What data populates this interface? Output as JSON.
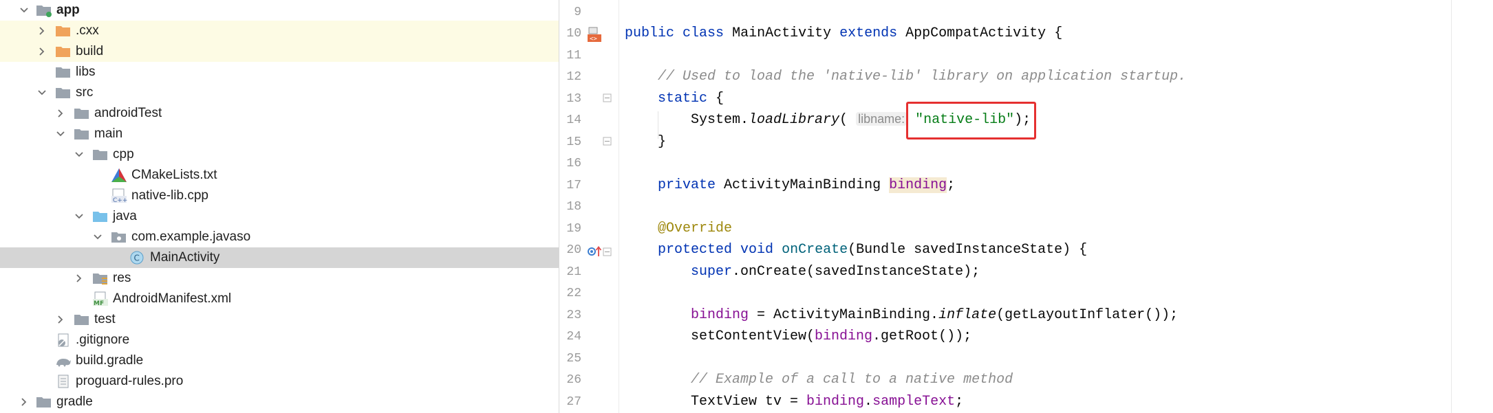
{
  "project_tree": {
    "items": [
      {
        "label": "app",
        "icon": "module-folder-icon",
        "bold": true
      },
      {
        "label": ".cxx",
        "icon": "orange-folder-icon"
      },
      {
        "label": "build",
        "icon": "orange-folder-icon"
      },
      {
        "label": "libs",
        "icon": "folder-icon"
      },
      {
        "label": "src",
        "icon": "folder-icon"
      },
      {
        "label": "androidTest",
        "icon": "folder-icon"
      },
      {
        "label": "main",
        "icon": "folder-icon"
      },
      {
        "label": "cpp",
        "icon": "folder-icon"
      },
      {
        "label": "CMakeLists.txt",
        "icon": "cmake-icon"
      },
      {
        "label": "native-lib.cpp",
        "icon": "cpp-file-icon"
      },
      {
        "label": "java",
        "icon": "source-folder-icon"
      },
      {
        "label": "com.example.javaso",
        "icon": "package-icon"
      },
      {
        "label": "MainActivity",
        "icon": "java-class-icon"
      },
      {
        "label": "res",
        "icon": "resources-folder-icon"
      },
      {
        "label": "AndroidManifest.xml",
        "icon": "manifest-icon"
      },
      {
        "label": "test",
        "icon": "folder-icon"
      },
      {
        "label": ".gitignore",
        "icon": "gitignore-icon"
      },
      {
        "label": "build.gradle",
        "icon": "gradle-icon"
      },
      {
        "label": "proguard-rules.pro",
        "icon": "file-icon"
      },
      {
        "label": "gradle",
        "icon": "folder-icon"
      }
    ]
  },
  "editor": {
    "line_numbers": [
      "9",
      "10",
      "11",
      "12",
      "13",
      "14",
      "15",
      "16",
      "17",
      "18",
      "19",
      "20",
      "21",
      "22",
      "23",
      "24",
      "25",
      "26",
      "27"
    ],
    "code": {
      "l10": {
        "public": "public",
        "class": "class",
        "name": "MainActivity",
        "extends": "extends",
        "parent": "AppCompatActivity",
        "brace": "{"
      },
      "l12": "// Used to load the 'native-lib' library on application startup.",
      "l13": {
        "static": "static",
        "brace": "{"
      },
      "l14": {
        "sys": "System.",
        "call": "loadLibrary",
        "open": "(",
        "hint": "libname:",
        "str": "\"native-lib\"",
        "close": ");"
      },
      "l15": "}",
      "l17": {
        "private": "private",
        "type": "ActivityMainBinding",
        "field": "binding",
        "semi": ";"
      },
      "l19": "@Override",
      "l20": {
        "protected": "protected",
        "void": "void",
        "name": "onCreate",
        "rest": "(Bundle savedInstanceState) {"
      },
      "l21": {
        "super": "super",
        "rest": ".onCreate(savedInstanceState);"
      },
      "l23": {
        "field": "binding",
        "eq": " = ActivityMainBinding.",
        "call": "inflate",
        "rest": "(getLayoutInflater());"
      },
      "l24": {
        "pre": "setContentView(",
        "field": "binding",
        "rest": ".getRoot());"
      },
      "l26": "// Example of a call to a native method",
      "l27": {
        "pre": "TextView tv = ",
        "field": "binding",
        "mid": ".",
        "field2": "sampleText",
        "rest": ";"
      }
    }
  },
  "colors": {
    "keyword": "#0033b3",
    "comment": "#8c8c8c",
    "string": "#067d17",
    "field": "#871094",
    "annotation": "#9e880d",
    "method": "#00627a",
    "highlight_box": "#e53030",
    "selected_row": "#d5d5d5",
    "excluded_row": "#fdfbe4"
  }
}
